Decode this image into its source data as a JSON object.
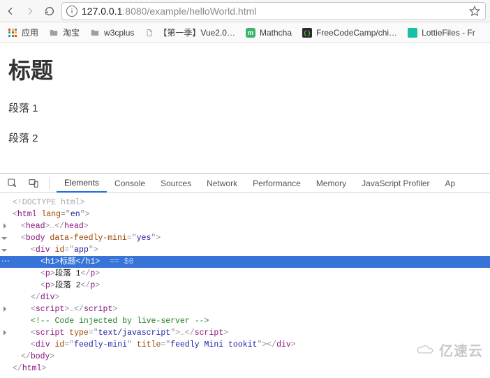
{
  "browser": {
    "url_host": "127.0.0.1",
    "url_port": ":8080",
    "url_path": "/example/helloWorld.html"
  },
  "bookmarks": {
    "apps": "应用",
    "b1": "淘宝",
    "b2": "w3cplus",
    "b3": "【第一季】Vue2.0…",
    "b4": "Mathcha",
    "b5": "FreeCodeCamp/chi…",
    "b6": "LottieFiles - Fr"
  },
  "page": {
    "heading": "标题",
    "p1": "段落 1",
    "p2": "段落 2"
  },
  "devtools": {
    "tabs": {
      "elements": "Elements",
      "console": "Console",
      "sources": "Sources",
      "network": "Network",
      "performance": "Performance",
      "memory": "Memory",
      "profiler": "JavaScript Profiler",
      "application": "Ap"
    },
    "lines": {
      "l0": "<!DOCTYPE html>",
      "l1_open": "<",
      "l1_tag": "html",
      "l1_attr": " lang",
      "l1_eq": "=\"",
      "l1_val": "en",
      "l1_close": "\">",
      "l2": "<head>…</head>",
      "l3_a": "<",
      "l3_tag": "body",
      "l3_attr": " data-feedly-mini",
      "l3_val": "yes",
      "l4_a": "<",
      "l4_tag": "div",
      "l4_attr": " id",
      "l4_val": "app",
      "l5_a": "<",
      "l5_tag": "h1",
      "l5_txt": "标题",
      "l5_tail": " == $0",
      "l6_a": "<",
      "l6_tag": "p",
      "l6_txt": "段落 1",
      "l7_a": "<",
      "l7_tag": "p",
      "l7_txt": "段落 2",
      "l8": "</div>",
      "l9": "<script>…</scr",
      "l10": "<!-- Code injected by live-server -->",
      "l11_a": "<",
      "l11_tag": "script",
      "l11_attr": " type",
      "l11_val": "text/javascript",
      "l12_a": "<",
      "l12_tag": "div",
      "l12_attr1": " id",
      "l12_val1": "feedly-mini",
      "l12_attr2": " title",
      "l12_val2": "feedly Mini tookit",
      "l13": "</body>",
      "l14": "</html>"
    }
  },
  "watermark": "亿速云"
}
